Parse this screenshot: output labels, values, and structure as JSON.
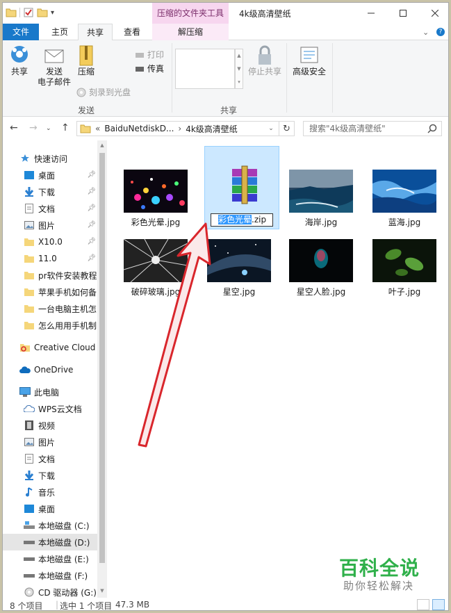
{
  "titlebar": {
    "contextual_tab": "压缩的文件夹工具",
    "title": "4k级高清壁纸",
    "qat_customize": "▾"
  },
  "ribbon_tabs": {
    "file": "文件",
    "home": "主页",
    "share": "共享",
    "view": "查看",
    "extract": "解压缩"
  },
  "ribbon": {
    "share_btn": "共享",
    "email_btn_1": "发送",
    "email_btn_2": "电子邮件",
    "zip_btn": "压缩",
    "print": "打印",
    "fax": "传真",
    "burn": "刻录到光盘",
    "group_send": "发送",
    "stop_share": "停止共享",
    "advanced_security": "高级安全",
    "group_share": "共享"
  },
  "address": {
    "chevron": "«",
    "crumb1": "BaiduNetdiskD...",
    "crumb2": "4k级高清壁纸",
    "search_placeholder": "搜索\"4k级高清壁纸\""
  },
  "nav": {
    "quick_access": "快速访问",
    "desktop": "桌面",
    "downloads": "下载",
    "documents": "文档",
    "pictures": "图片",
    "x10": "X10.0",
    "f11": "11.0",
    "pr": "pr软件安装教程",
    "apple": "苹果手机如何备",
    "pc": "一台电脑主机怎",
    "phone": "怎么用用手机制",
    "creative_cloud": "Creative Cloud",
    "onedrive": "OneDrive",
    "this_pc": "此电脑",
    "wps": "WPS云文档",
    "videos": "视频",
    "pc_pictures": "图片",
    "pc_documents": "文档",
    "pc_downloads": "下载",
    "music": "音乐",
    "pc_desktop": "桌面",
    "drive_c": "本地磁盘 (C:)",
    "drive_d": "本地磁盘 (D:)",
    "drive_e": "本地磁盘 (E:)",
    "drive_f": "本地磁盘 (F:)",
    "drive_g": "CD 驱动器 (G:)"
  },
  "files": {
    "f1": "彩色光晕.jpg",
    "f2_sel": "彩色光晕",
    "f2_ext": ".zip",
    "f3": "海岸.jpg",
    "f4": "蓝海.jpg",
    "f5": "破碎玻璃.jpg",
    "f6": "星空.jpg",
    "f7": "星空人脸.jpg",
    "f8": "叶子.jpg"
  },
  "status": {
    "count": "8 个项目",
    "selected": "选中 1 个项目",
    "size": "47.3 MB"
  },
  "watermark": {
    "line1": "百科全说",
    "line2": "助你轻松解决"
  },
  "colors": {
    "accent": "#1979ca",
    "selection": "#cce8ff",
    "context_tab": "#f7d6ef",
    "annotation_arrow": "#d9262c",
    "watermark_green": "#2fb04a"
  }
}
